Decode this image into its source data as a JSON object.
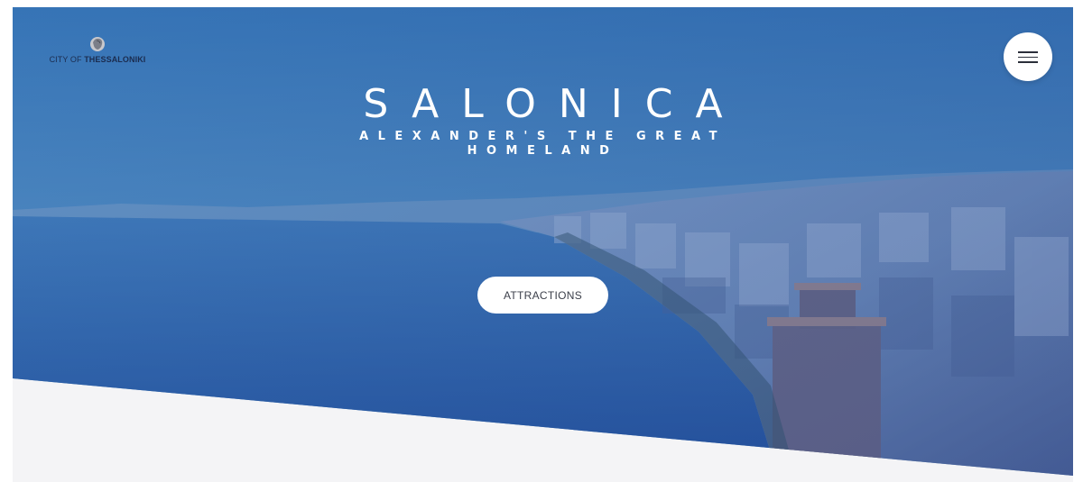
{
  "brand": {
    "prefix": "CITY OF ",
    "name": "THESSALONIKI",
    "emblem_icon": "alexander-head-icon"
  },
  "menu": {
    "icon": "hamburger-menu-icon"
  },
  "hero": {
    "title": "SALONICA",
    "subtitle": "ALEXANDER'S THE GREAT HOMELAND",
    "cta_label": "ATTRACTIONS"
  },
  "colors": {
    "overlay": "#2f5fae",
    "sea": "#2d5fa3",
    "sky": "#6aa9cf",
    "footer_band": "#f4f4f6"
  }
}
